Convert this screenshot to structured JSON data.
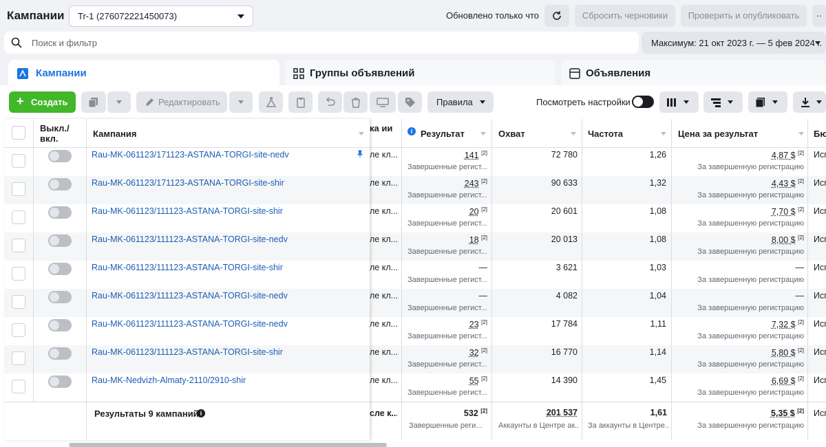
{
  "header": {
    "title": "Кампании",
    "account": "Tr-1 (276072221450073)",
    "updated": "Обновлено только что",
    "reset_drafts": "Сбросить черновики",
    "review_publish": "Проверить и опубликовать",
    "more": "··"
  },
  "search": {
    "placeholder": "Поиск и фильтр"
  },
  "date_range": "Максимум: 21 окт 2023 г. — 5 фев 2024 г.",
  "tabs": [
    {
      "label": "Кампании"
    },
    {
      "label": "Группы объявлений"
    },
    {
      "label": "Объявления"
    }
  ],
  "toolbar": {
    "create": "Создать",
    "edit": "Редактировать",
    "rules": "Правила",
    "view_settings": "Посмотреть настройки"
  },
  "columns": {
    "onoff": "Выкл./ вкл.",
    "campaign": "Кампания",
    "bid": "ка ии",
    "result": "Результат",
    "reach": "Охват",
    "frequency": "Частота",
    "cost": "Цена за результат",
    "budget": "Бю"
  },
  "rows": [
    {
      "name": "Rau-MK-061123/171123-ASTANA-TORGI-site-nedv",
      "bid": "ле кл...",
      "result": "141",
      "result_sub": "Завершенные регист...",
      "reach": "72 780",
      "freq": "1,26",
      "cost": "4,87 $",
      "cost_sub": "За завершенную регистрацию",
      "budget": "Исп"
    },
    {
      "name": "Rau-MK-061123/171123-ASTANA-TORGI-site-shir",
      "bid": "ле кл...",
      "result": "243",
      "result_sub": "Завершенные регист...",
      "reach": "90 633",
      "freq": "1,32",
      "cost": "4,43 $",
      "cost_sub": "За завершенную регистрацию",
      "budget": "Исп"
    },
    {
      "name": "Rau-MK-061123/111123-ASTANA-TORGI-site-shir",
      "bid": "ле кл...",
      "result": "20",
      "result_sub": "Завершенные регист...",
      "reach": "20 601",
      "freq": "1,08",
      "cost": "7,70 $",
      "cost_sub": "За завершенную регистрацию",
      "budget": "Исп"
    },
    {
      "name": "Rau-MK-061123/111123-ASTANA-TORGI-site-nedv",
      "bid": "ле кл...",
      "result": "18",
      "result_sub": "Завершенные регист...",
      "reach": "20 013",
      "freq": "1,08",
      "cost": "8,00 $",
      "cost_sub": "За завершенную регистрацию",
      "budget": "Исп"
    },
    {
      "name": "Rau-MK-061123/111123-ASTANA-TORGI-site-shir",
      "bid": "ле кл...",
      "result": "—",
      "result_sub": "Завершенные регист...",
      "reach": "3 621",
      "freq": "1,03",
      "cost": "—",
      "cost_sub": "За завершенную регистрацию",
      "budget": "Исп"
    },
    {
      "name": "Rau-MK-061123/111123-ASTANA-TORGI-site-nedv",
      "bid": "ле кл...",
      "result": "—",
      "result_sub": "Завершенные регист...",
      "reach": "4 082",
      "freq": "1,04",
      "cost": "—",
      "cost_sub": "За завершенную регистрацию",
      "budget": "Исп"
    },
    {
      "name": "Rau-MK-061123/111123-ASTANA-TORGI-site-nedv",
      "bid": "ле кл...",
      "result": "23",
      "result_sub": "Завершенные регист...",
      "reach": "17 784",
      "freq": "1,11",
      "cost": "7,32 $",
      "cost_sub": "За завершенную регистрацию",
      "budget": "Исп"
    },
    {
      "name": "Rau-MK-061123/111123-ASTANA-TORGI-site-shir",
      "bid": "ле кл...",
      "result": "32",
      "result_sub": "Завершенные регист...",
      "reach": "16 770",
      "freq": "1,14",
      "cost": "5,80 $",
      "cost_sub": "За завершенную регистрацию",
      "budget": "Исп"
    },
    {
      "name": "Rau-MK-Nedvizh-Almaty-2110/2910-shir",
      "bid": "ле кл...",
      "result": "55",
      "result_sub": "Завершенные регист...",
      "reach": "14 390",
      "freq": "1,45",
      "cost": "6,69 $",
      "cost_sub": "За завершенную регистрацию",
      "budget": "Исп"
    }
  ],
  "totals": {
    "label": "Результаты 9 кампаний",
    "bid": "сле к...",
    "result": "532",
    "result_sub": "Завершенные реги...",
    "reach": "201 537",
    "reach_sub": "Аккаунты в Центре ак...",
    "freq": "1,61",
    "freq_sub": "За аккаунты в Центре...",
    "cost": "5,35 $",
    "cost_sub": "За завершенную регистрацию",
    "budget": "Исп"
  },
  "superscript": "[2]",
  "colors": {
    "accent": "#1b74e4",
    "create": "#42b72a",
    "link": "#1b5eb5"
  }
}
